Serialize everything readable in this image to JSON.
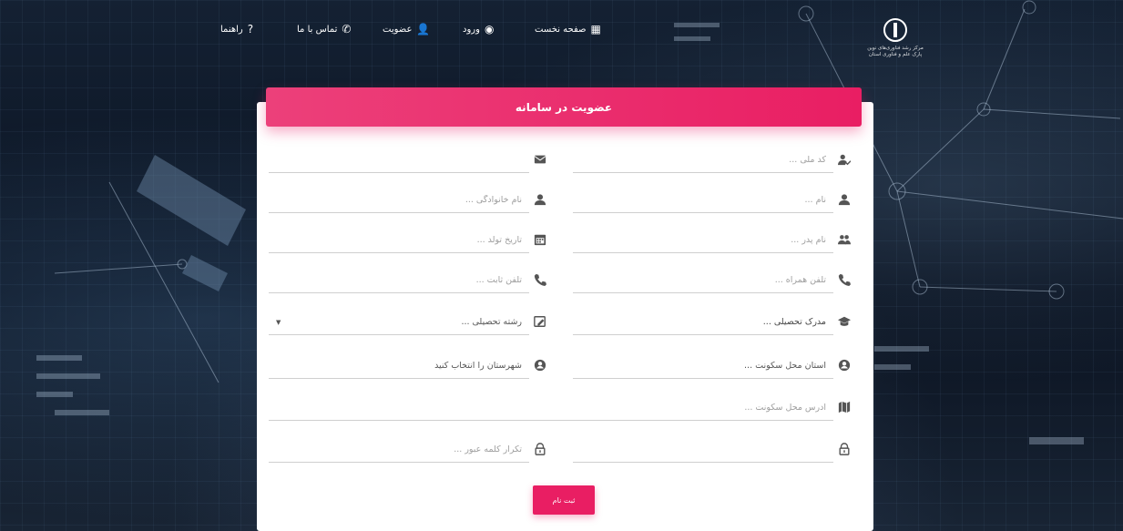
{
  "nav": {
    "home": "صفحه نخست",
    "login": "ورود",
    "signup": "عضویت",
    "contact": "تماس با ما",
    "help": "راهنما"
  },
  "logo": {
    "tagline": "مرکز رشد فناوری‌های نوین پارک علم و فناوری استان"
  },
  "form": {
    "title": "عضویت در سامانه",
    "national_code": "کد ملی ...",
    "email": "",
    "first_name": "نام ...",
    "last_name": "نام خانوادگی ...",
    "father_name": "نام پدر ...",
    "birth_date": "تاریخ تولد ...",
    "mobile": "تلفن همراه ...",
    "phone": "تلفن ثابت ...",
    "degree": "مدرک تحصیلی ...",
    "field_of_study": "رشته تحصیلی ...",
    "province": "استان محل سکونت ...",
    "city": "شهرستان را انتخاب کنید",
    "address": "آدرس محل سکونت ...",
    "password": "",
    "password_repeat": "تکرار کلمه عبور ...",
    "submit": "ثبت نام"
  },
  "colors": {
    "accent": "#e91e63",
    "header_gradient_start": "#ec407a"
  }
}
